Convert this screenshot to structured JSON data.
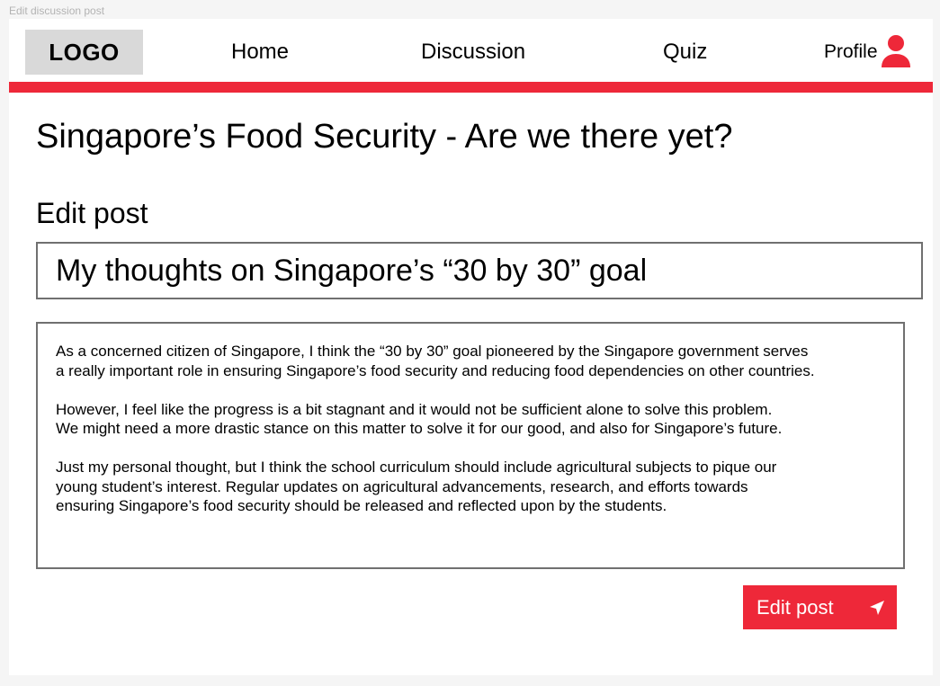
{
  "frame_label": "Edit discussion post",
  "brand": {
    "logo_text": "LOGO"
  },
  "nav": {
    "home": "Home",
    "discussion": "Discussion",
    "quiz": "Quiz",
    "profile": "Profile"
  },
  "icons": {
    "profile": "user-icon",
    "submit": "send-icon"
  },
  "colors": {
    "accent": "#ee2839",
    "logo_bg": "#d9d9d9"
  },
  "page": {
    "title": "Singapore’s Food Security - Are we there yet?",
    "section_heading": "Edit post"
  },
  "form": {
    "post_title_value": "My thoughts on Singapore’s “30 by 30” goal",
    "post_body_paragraphs": [
      "As a concerned citizen of Singapore, I think the “30 by 30” goal pioneered by the Singapore government serves\na really important role in ensuring Singapore’s food security and reducing food dependencies on other countries.",
      "However, I feel like the progress is a bit stagnant and it would not be sufficient alone to solve this problem.\nWe might need a more drastic stance on this matter to solve it for our good, and also for Singapore’s future.",
      "Just my personal thought, but I think the school curriculum should include agricultural subjects to pique our\nyoung student’s interest. Regular updates on agricultural advancements, research, and efforts towards\nensuring Singapore’s food security should be released and reflected upon by the students."
    ],
    "submit_label": "Edit post"
  }
}
